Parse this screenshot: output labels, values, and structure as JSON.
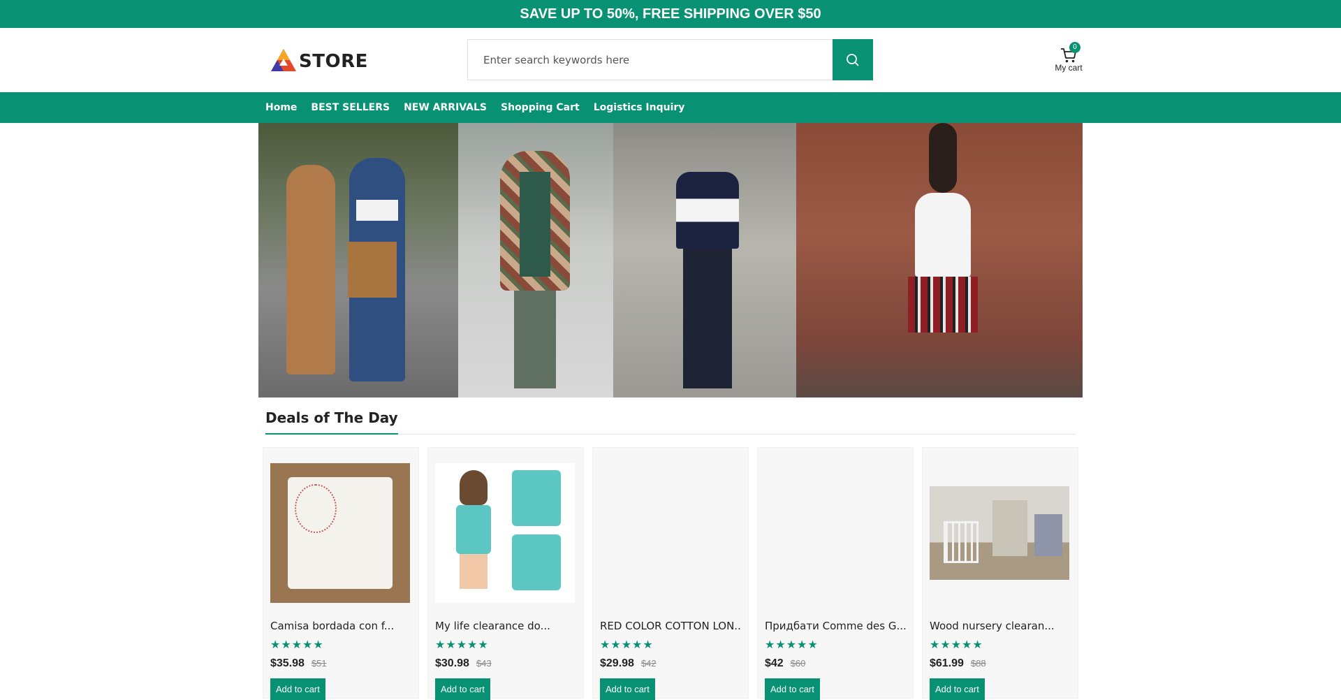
{
  "promo": {
    "text": "SAVE UP TO 50%, FREE SHIPPING OVER $50"
  },
  "header": {
    "logo_text": "STORE",
    "search_placeholder": "Enter search keywords here",
    "cart_count": "0",
    "cart_label": "My cart"
  },
  "nav": {
    "items": [
      {
        "label": "Home"
      },
      {
        "label": "BEST SELLERS"
      },
      {
        "label": "NEW ARRIVALS"
      },
      {
        "label": "Shopping Cart"
      },
      {
        "label": "Logistics Inquiry"
      }
    ]
  },
  "deals": {
    "title": "Deals of The Day",
    "products": [
      {
        "name": "Camisa bordada con f...",
        "price": "$35.98",
        "old_price": "$51",
        "stars": "★★★★★",
        "button": "Add to cart"
      },
      {
        "name": "My life clearance do...",
        "price": "$30.98",
        "old_price": "$43",
        "stars": "★★★★★",
        "button": "Add to cart"
      },
      {
        "name": "RED COLOR COTTON LON...",
        "price": "$29.98",
        "old_price": "$42",
        "stars": "★★★★★",
        "button": "Add to cart"
      },
      {
        "name": "Придбати Comme des G...",
        "price": "$42",
        "old_price": "$60",
        "stars": "★★★★★",
        "button": "Add to cart"
      },
      {
        "name": "Wood nursery clearan...",
        "price": "$61.99",
        "old_price": "$88",
        "stars": "★★★★★",
        "button": "Add to cart"
      }
    ]
  },
  "colors": {
    "accent": "#089273"
  }
}
